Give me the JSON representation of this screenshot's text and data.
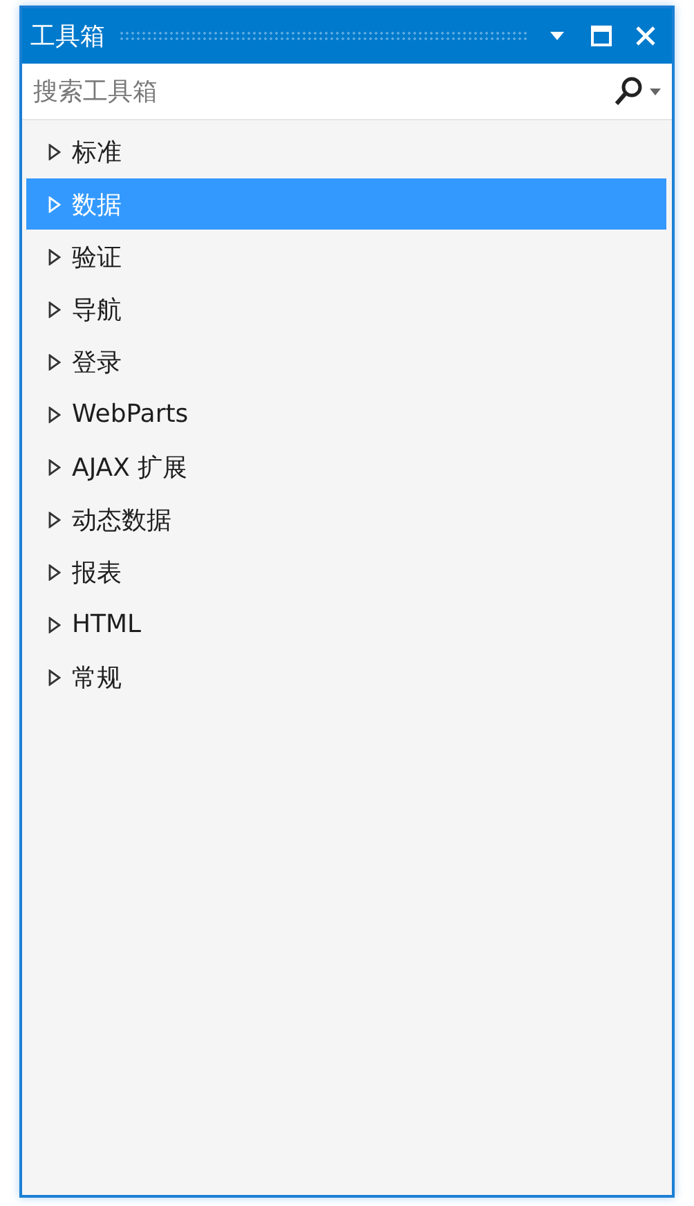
{
  "window": {
    "title": "工具箱"
  },
  "search": {
    "placeholder": "搜索工具箱"
  },
  "groups": [
    {
      "label": "标准",
      "selected": false
    },
    {
      "label": "数据",
      "selected": true
    },
    {
      "label": "验证",
      "selected": false
    },
    {
      "label": "导航",
      "selected": false
    },
    {
      "label": "登录",
      "selected": false
    },
    {
      "label": "WebParts",
      "selected": false
    },
    {
      "label": "AJAX 扩展",
      "selected": false
    },
    {
      "label": "动态数据",
      "selected": false
    },
    {
      "label": "报表",
      "selected": false
    },
    {
      "label": "HTML",
      "selected": false
    },
    {
      "label": "常规",
      "selected": false
    }
  ]
}
